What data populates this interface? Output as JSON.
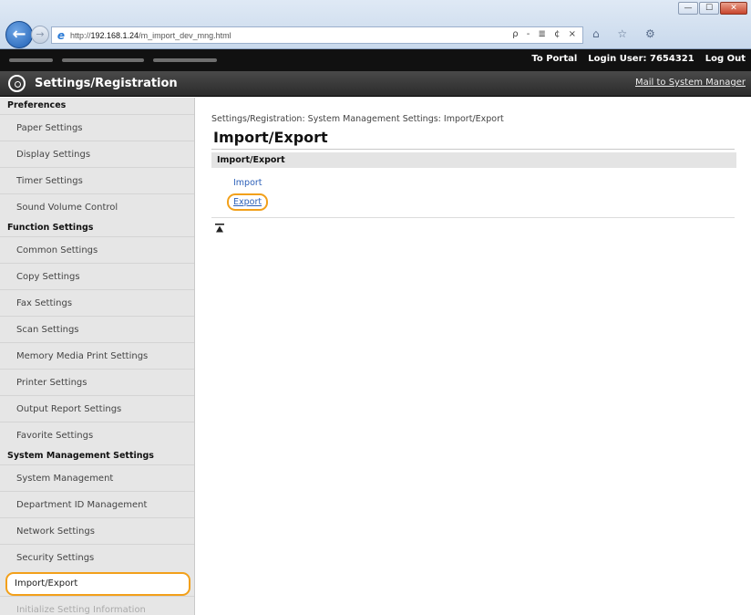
{
  "browser": {
    "url_prefix": "http://",
    "url_host": "192.168.1.24",
    "url_path": "/m_import_dev_mng.html",
    "address_controls": "ρ - ≣ ¢ ×",
    "minimize": "—",
    "maximize": "☐",
    "close": "✕",
    "back_icon": "arrow-left-icon",
    "forward_icon": "arrow-right-icon",
    "tools": "⌂ ☆ ⚙"
  },
  "portal": {
    "to_portal": "To Portal",
    "login_user": "Login User:  7654321",
    "logout": "Log Out"
  },
  "header": {
    "title": "Settings/Registration",
    "mail_link": "Mail to System Manager"
  },
  "sidebar": {
    "preferences_heading": "Preferences",
    "preferences": [
      "Paper Settings",
      "Display Settings",
      "Timer Settings",
      "Sound Volume Control"
    ],
    "function_heading": "Function Settings",
    "function": [
      "Common Settings",
      "Copy Settings",
      "Fax Settings",
      "Scan Settings",
      "Memory Media Print Settings",
      "Printer Settings",
      "Output Report Settings",
      "Favorite Settings"
    ],
    "system_heading": "System Management Settings",
    "system": [
      "System Management",
      "Department ID Management",
      "Network Settings",
      "Security Settings"
    ],
    "selected": "Import/Export",
    "faded": "Initialize Setting Information"
  },
  "main": {
    "breadcrumb": "Settings/Registration: System Management Settings: Import/Export",
    "title": "Import/Export",
    "section_header": "Import/Export",
    "import_link": "Import",
    "export_link": "Export"
  },
  "colors": {
    "highlight": "#f2a01a",
    "link": "#2b5fb8",
    "header_bg": "#2b2b2b"
  }
}
